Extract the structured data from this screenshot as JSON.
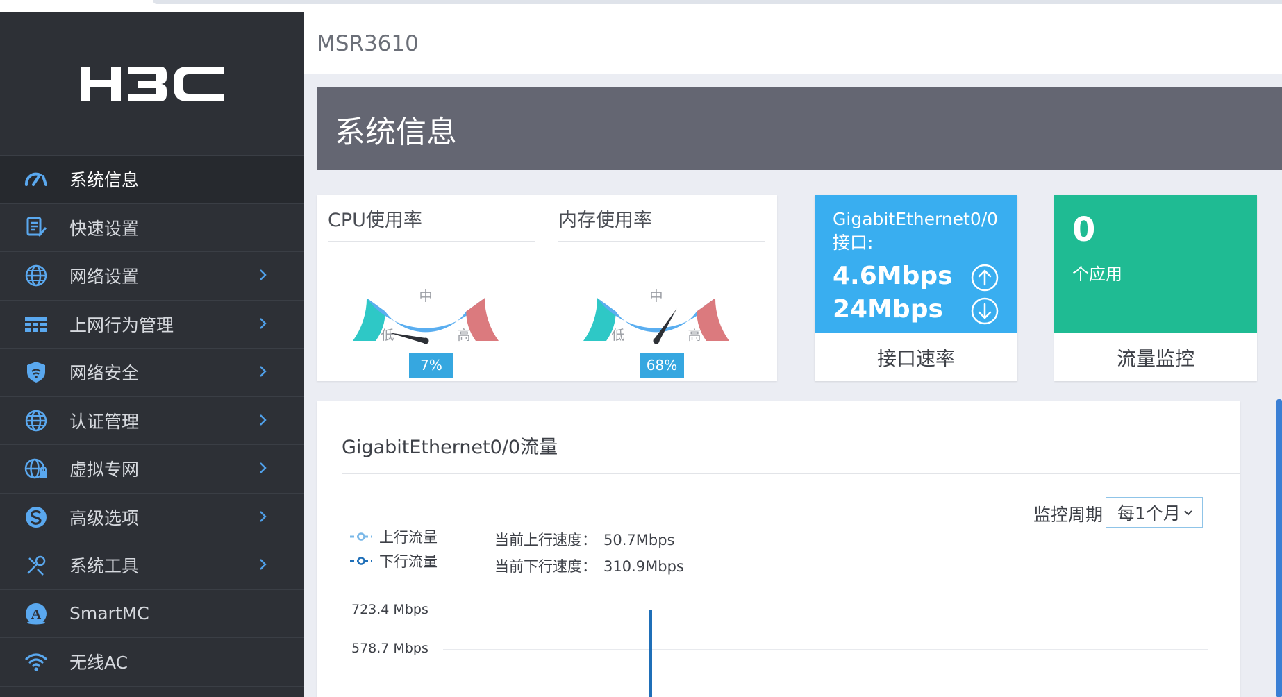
{
  "device": {
    "name": "MSR3610"
  },
  "sidebar": {
    "logo_text": "H3C",
    "items": [
      {
        "label": "系统信息",
        "icon": "dashboard-icon",
        "expandable": false,
        "active": true
      },
      {
        "label": "快速设置",
        "icon": "quick-setup-icon",
        "expandable": false,
        "active": false
      },
      {
        "label": "网络设置",
        "icon": "globe-icon",
        "expandable": true,
        "active": false
      },
      {
        "label": "上网行为管理",
        "icon": "behavior-icon",
        "expandable": true,
        "active": false
      },
      {
        "label": "网络安全",
        "icon": "shield-icon",
        "expandable": true,
        "active": false
      },
      {
        "label": "认证管理",
        "icon": "globe-icon",
        "expandable": true,
        "active": false
      },
      {
        "label": "虚拟专网",
        "icon": "vpn-globe-icon",
        "expandable": true,
        "active": false
      },
      {
        "label": "高级选项",
        "icon": "advanced-icon",
        "expandable": true,
        "active": false
      },
      {
        "label": "系统工具",
        "icon": "tools-icon",
        "expandable": true,
        "active": false
      },
      {
        "label": "SmartMC",
        "icon": "smartmc-icon",
        "expandable": false,
        "active": false
      },
      {
        "label": "无线AC",
        "icon": "wifi-icon",
        "expandable": false,
        "active": false
      }
    ]
  },
  "page": {
    "title": "系统信息"
  },
  "cpu": {
    "title": "CPU使用率",
    "value_label": "7%",
    "value": 7
  },
  "memory": {
    "title": "内存使用率",
    "value_label": "68%",
    "value": 68
  },
  "gauge_labels": {
    "low": "低",
    "mid": "中",
    "high": "高"
  },
  "interface_tile": {
    "interface": "GigabitEthernet0/0",
    "suffix": "接口:",
    "upload": "4.6Mbps",
    "download": "24Mbps",
    "footer": "接口速率"
  },
  "app_tile": {
    "count": "0",
    "label": "个应用",
    "footer": "流量监控"
  },
  "traffic": {
    "title": "GigabitEthernet0/0流量",
    "period_label": "监控周期",
    "period_value": "每1个月",
    "legend_up": "上行流量",
    "legend_down": "下行流量",
    "current_up_label": "当前上行速度：",
    "current_up_value": "50.7Mbps",
    "current_down_label": "当前下行速度：",
    "current_down_value": "310.9Mbps",
    "y_ticks": [
      "723.4 Mbps",
      "578.7 Mbps"
    ]
  },
  "colors": {
    "sidebar_bg": "#2d3036",
    "banner_bg": "#646672",
    "rate_tile": "#39aef0",
    "app_tile": "#1fbb93",
    "gauge_low": "#2ec8c6",
    "gauge_mid": "#5aaef0",
    "gauge_high": "#db7a7e",
    "up_line": "#7ab8e8",
    "down_line": "#1f6fb8"
  }
}
